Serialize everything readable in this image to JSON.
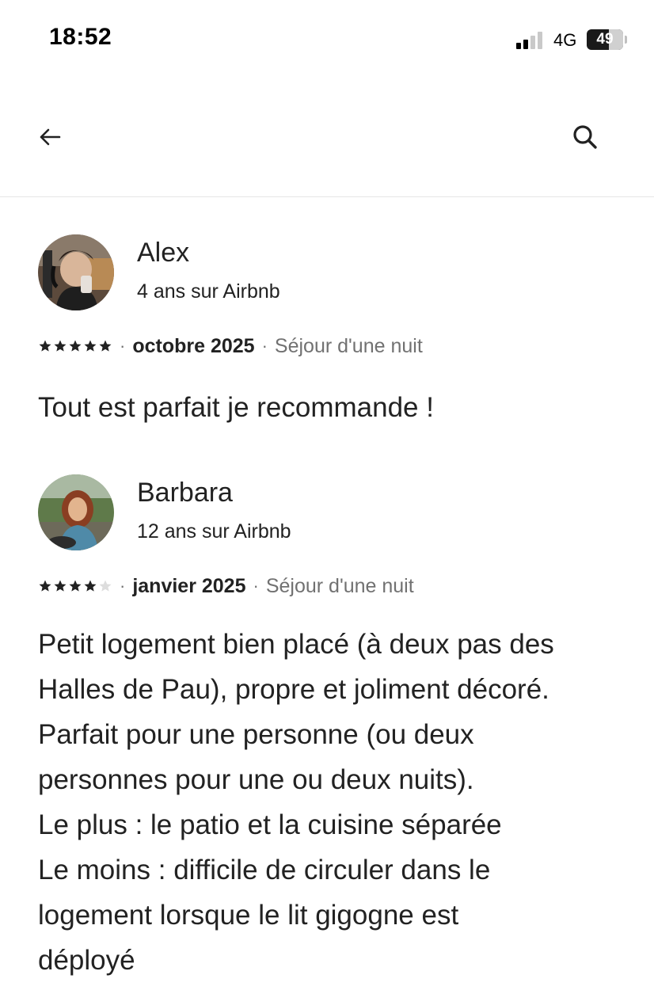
{
  "status_bar": {
    "time": "18:52",
    "network": "4G",
    "battery": "49"
  },
  "nav": {
    "back_icon": "arrow-left-icon",
    "search_icon": "search-icon"
  },
  "reviews": [
    {
      "name": "Alex",
      "tenure": "4 ans sur Airbnb",
      "rating": 5,
      "date": "octobre 2025",
      "stay": "Séjour d'une nuit",
      "comment": "Tout est parfait je recommande !"
    },
    {
      "name": "Barbara",
      "tenure": "12 ans sur Airbnb",
      "rating": 4,
      "date": "janvier 2025",
      "stay": "Séjour d'une nuit",
      "comment": "Petit logement bien placé (à deux pas des\nHalles de Pau), propre et joliment décoré.\nParfait pour une personne (ou deux\npersonnes pour une ou deux nuits).\nLe plus : le patio et la cuisine séparée\nLe moins : difficile de circuler dans le\nlogement lorsque le lit gigogne est\ndéployé"
    }
  ],
  "colors": {
    "text": "#222222",
    "muted": "#717171",
    "divider": "#e6e6e6",
    "star_filled": "#222222",
    "star_empty": "#dddddd"
  }
}
